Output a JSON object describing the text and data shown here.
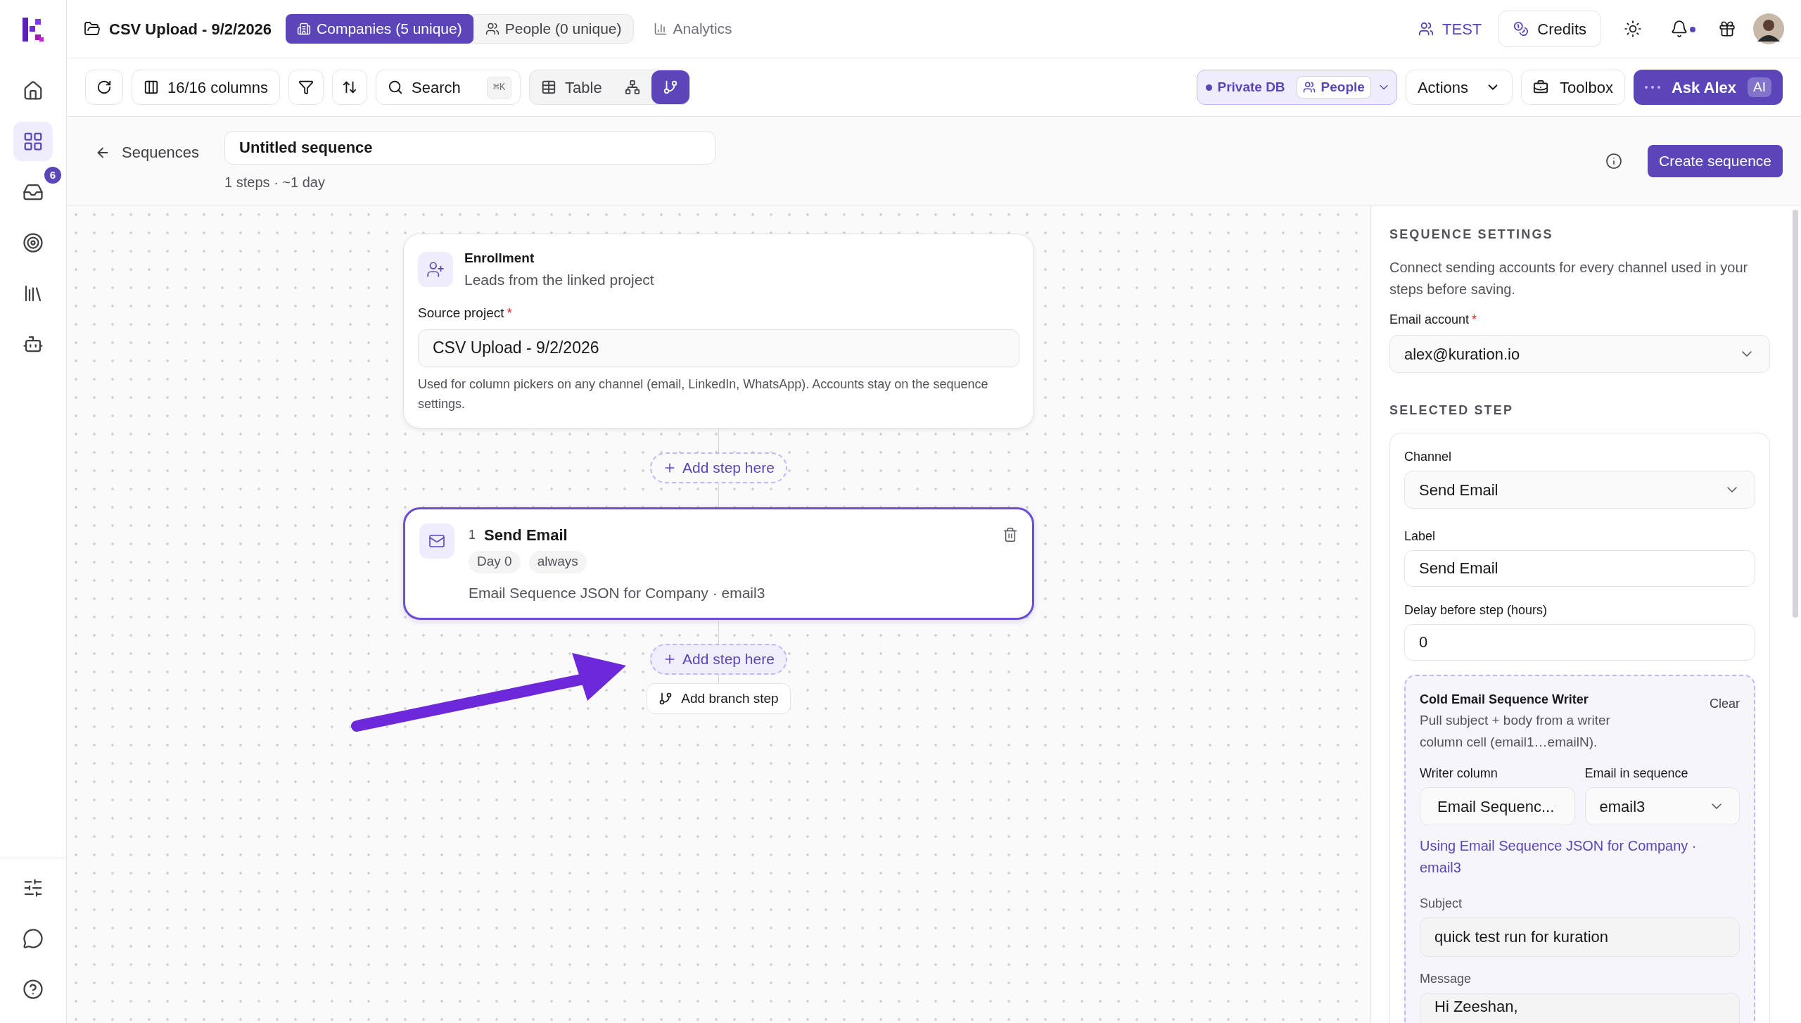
{
  "project": {
    "title": "CSV Upload - 9/2/2026"
  },
  "view_tabs": [
    {
      "kind": "companies",
      "label": "Companies (5 unique)",
      "selected": true
    },
    {
      "kind": "people",
      "label": "People (0 unique)",
      "selected": false
    },
    {
      "kind": "analytics",
      "label": "Analytics",
      "selected": false
    }
  ],
  "header_right": {
    "workspace": "TEST",
    "credits": "Credits",
    "notifications_unread": true
  },
  "sidebar": {
    "items": [
      {
        "kind": "home",
        "selected": false
      },
      {
        "kind": "grid",
        "selected": true
      },
      {
        "kind": "inbox",
        "selected": false,
        "badge": "6"
      },
      {
        "kind": "target",
        "selected": false
      },
      {
        "kind": "library",
        "selected": false
      },
      {
        "kind": "bot",
        "selected": false
      }
    ],
    "bottom_items": [
      {
        "kind": "sliders",
        "selected": false
      },
      {
        "kind": "chat",
        "selected": false
      },
      {
        "kind": "help",
        "selected": false
      }
    ]
  },
  "toolbar": {
    "columns": "16/16 columns",
    "search": {
      "label": "Search",
      "shortcut": "⌘K"
    },
    "views": [
      {
        "kind": "table",
        "label": "Table",
        "selected": false
      },
      {
        "kind": "tree",
        "selected": false
      },
      {
        "kind": "sequence",
        "selected": true
      }
    ],
    "db": {
      "label": "Private DB",
      "entity": "People"
    },
    "actions": "Actions",
    "toolbox": "Toolbox",
    "ask": {
      "label": "Ask Alex",
      "badge": "AI"
    }
  },
  "sequence_header": {
    "back": "Sequences",
    "name": "Untitled sequence",
    "summary": "1 steps · ~1 day",
    "create": "Create sequence"
  },
  "canvas": {
    "enrollment": {
      "title": "Enrollment",
      "subtitle": "Leads from the linked project",
      "field_label": "Source project",
      "required_mark": "*",
      "value": "CSV Upload - 9/2/2026",
      "help": "Used for column pickers on any channel (email, LinkedIn, WhatsApp). Accounts stay on the sequence settings."
    },
    "add_step_buttons": [
      {
        "label": "Add step here",
        "highlighted": false
      },
      {
        "label": "Add step here",
        "highlighted": true
      }
    ],
    "steps": [
      {
        "number": "1",
        "title": "Send Email",
        "tags": [
          "Day 0",
          "always"
        ],
        "detail": "Email Sequence JSON for Company · email3",
        "selected": true
      }
    ],
    "branch_button": "Add branch step"
  },
  "settings": {
    "heading": "SEQUENCE SETTINGS",
    "description": "Connect sending accounts for every channel used in your steps before saving.",
    "email_account": {
      "label": "Email account",
      "required_mark": "*",
      "value": "alex@kuration.io"
    },
    "step_heading": "SELECTED STEP",
    "channel": {
      "label": "Channel",
      "value": "Send Email"
    },
    "step_label": {
      "label": "Label",
      "value": "Send Email"
    },
    "delay": {
      "label": "Delay before step (hours)",
      "value": "0"
    },
    "writer": {
      "title": "Cold Email Sequence Writer",
      "description": "Pull subject + body from a writer column cell (email1…emailN).",
      "clear": "Clear",
      "column": {
        "label": "Writer column",
        "value": "Email Sequenc..."
      },
      "email": {
        "label": "Email in sequence",
        "value": "email3"
      },
      "using": "Using Email Sequence JSON for Company · email3",
      "subject": {
        "label": "Subject",
        "value": "quick test run for kuration"
      },
      "message": {
        "label": "Message",
        "value": "Hi Zeeshan,"
      }
    }
  }
}
